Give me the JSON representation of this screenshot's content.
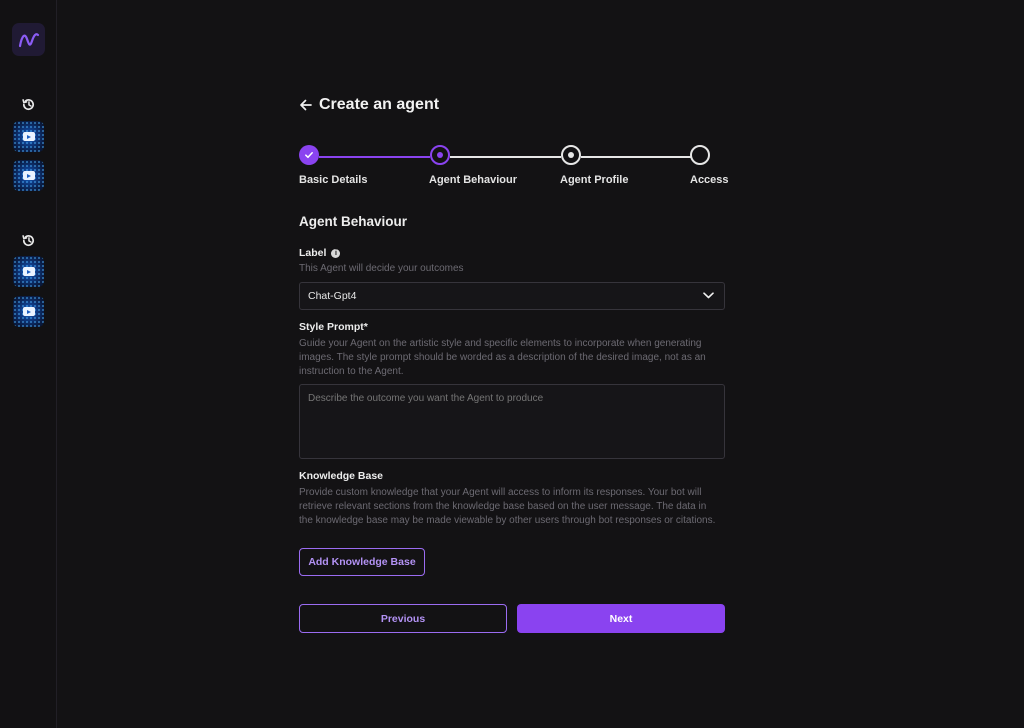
{
  "sidebar": {
    "logo_icon": "wave-logo-icon",
    "groups": [
      {
        "icon": "history-icon",
        "items": [
          "video-thumbnail-icon",
          "video-thumbnail-icon"
        ]
      },
      {
        "icon": "history-icon",
        "items": [
          "video-thumbnail-icon",
          "video-thumbnail-icon"
        ]
      }
    ]
  },
  "header": {
    "back_icon": "arrow-left-icon",
    "title": "Create an agent"
  },
  "stepper": {
    "steps": [
      {
        "label": "Basic Details",
        "state": "completed"
      },
      {
        "label": "Agent Behaviour",
        "state": "current"
      },
      {
        "label": "Agent Profile",
        "state": "upcoming"
      },
      {
        "label": "Access",
        "state": "upcoming"
      }
    ],
    "colors": {
      "active": "#8a43f0",
      "inactive": "#e6e6e6"
    }
  },
  "form": {
    "section_title": "Agent Behaviour",
    "label_field": {
      "label": "Label",
      "info_icon": "info-icon",
      "help": "This Agent will decide your outcomes",
      "value": "Chat-Gpt4",
      "chevron_icon": "chevron-down-icon"
    },
    "style_prompt": {
      "label": "Style Prompt*",
      "help": "Guide your Agent on the artistic style and specific elements to incorporate when generating images. The style prompt should be worded as a description of the desired image, not as an instruction to the Agent.",
      "placeholder": "Describe the outcome you want the Agent to produce",
      "value": ""
    },
    "knowledge_base": {
      "label": "Knowledge Base",
      "help": "Provide custom knowledge that your Agent will access to inform its responses. Your bot will retrieve relevant sections from the knowledge base based on the user message. The data in the knowledge base may be made viewable by other users through bot responses or citations.",
      "button": "Add Knowledge Base"
    }
  },
  "footer": {
    "previous": "Previous",
    "next": "Next"
  },
  "colors": {
    "background": "#131214",
    "accent": "#8a43f0",
    "accent_text": "#b392f4",
    "muted_text": "#6c6a72"
  }
}
